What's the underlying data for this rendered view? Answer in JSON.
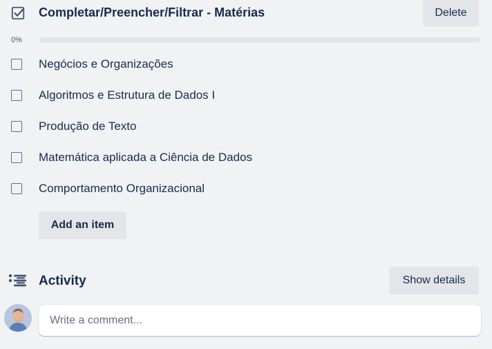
{
  "checklist": {
    "title": "Completar/Preencher/Filtrar - Matérias",
    "delete_label": "Delete",
    "progress": {
      "label": "0%",
      "value": 0
    },
    "items": [
      {
        "label": "Negócios e Organizações",
        "checked": false
      },
      {
        "label": "Algoritmos e Estrutura de Dados I",
        "checked": false
      },
      {
        "label": "Produção de Texto",
        "checked": false
      },
      {
        "label": "Matemática aplicada a Ciência de Dados",
        "checked": false
      },
      {
        "label": "Comportamento Organizacional",
        "checked": false
      }
    ],
    "add_item_label": "Add an item"
  },
  "activity": {
    "title": "Activity",
    "show_details_label": "Show details",
    "comment": {
      "placeholder": "Write a comment...",
      "value": ""
    }
  },
  "colors": {
    "background": "#f1f2f4",
    "text": "#172b4d",
    "button_bg": "#e3e5e9",
    "progress_fill": "#1f845a"
  },
  "icons": {
    "checklist": "checkbox-checked-icon",
    "activity": "activity-list-icon",
    "avatar": "user-avatar"
  }
}
